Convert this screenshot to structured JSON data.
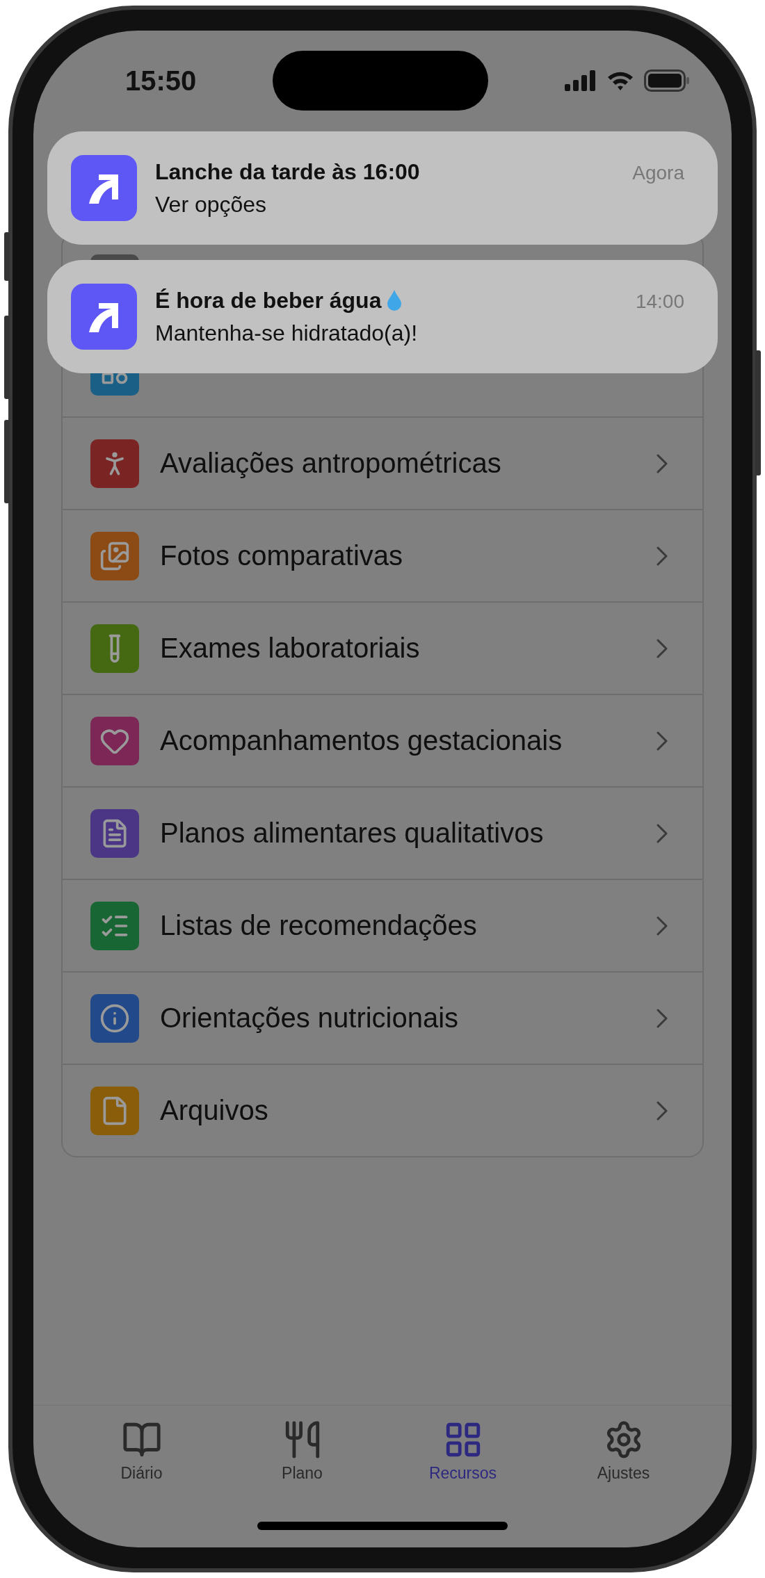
{
  "status_bar": {
    "time": "15:50"
  },
  "notifications": [
    {
      "title": "Lanche da tarde às 16:00",
      "body": "Ver opções",
      "time": "Agora",
      "droplet": false
    },
    {
      "title": "É hora de beber água",
      "body": "Mantenha-se hidratado(a)!",
      "time": "14:00",
      "droplet": true
    }
  ],
  "menu": [
    {
      "color": "#4a4a4a"
    },
    {
      "color": "#1a5f85"
    },
    {
      "label": "Avaliações antropométricas",
      "color": "#7b2424"
    },
    {
      "label": "Fotos comparativas",
      "color": "#8c4a14"
    },
    {
      "label": "Exames laboratoriais",
      "color": "#456912"
    },
    {
      "label": "Acompanhamentos gestacionais",
      "color": "#7c2756"
    },
    {
      "label": "Planos alimentares qualitativos",
      "color": "#4b3686"
    },
    {
      "label": "Listas de recomendações",
      "color": "#176633"
    },
    {
      "label": "Orientações nutricionais",
      "color": "#224a8a"
    },
    {
      "label": "Arquivos",
      "color": "#8a5d0a"
    }
  ],
  "tab_bar": [
    {
      "label": "Diário",
      "selected": false
    },
    {
      "label": "Plano",
      "selected": false
    },
    {
      "label": "Recursos",
      "selected": true
    },
    {
      "label": "Ajustes",
      "selected": false
    }
  ]
}
